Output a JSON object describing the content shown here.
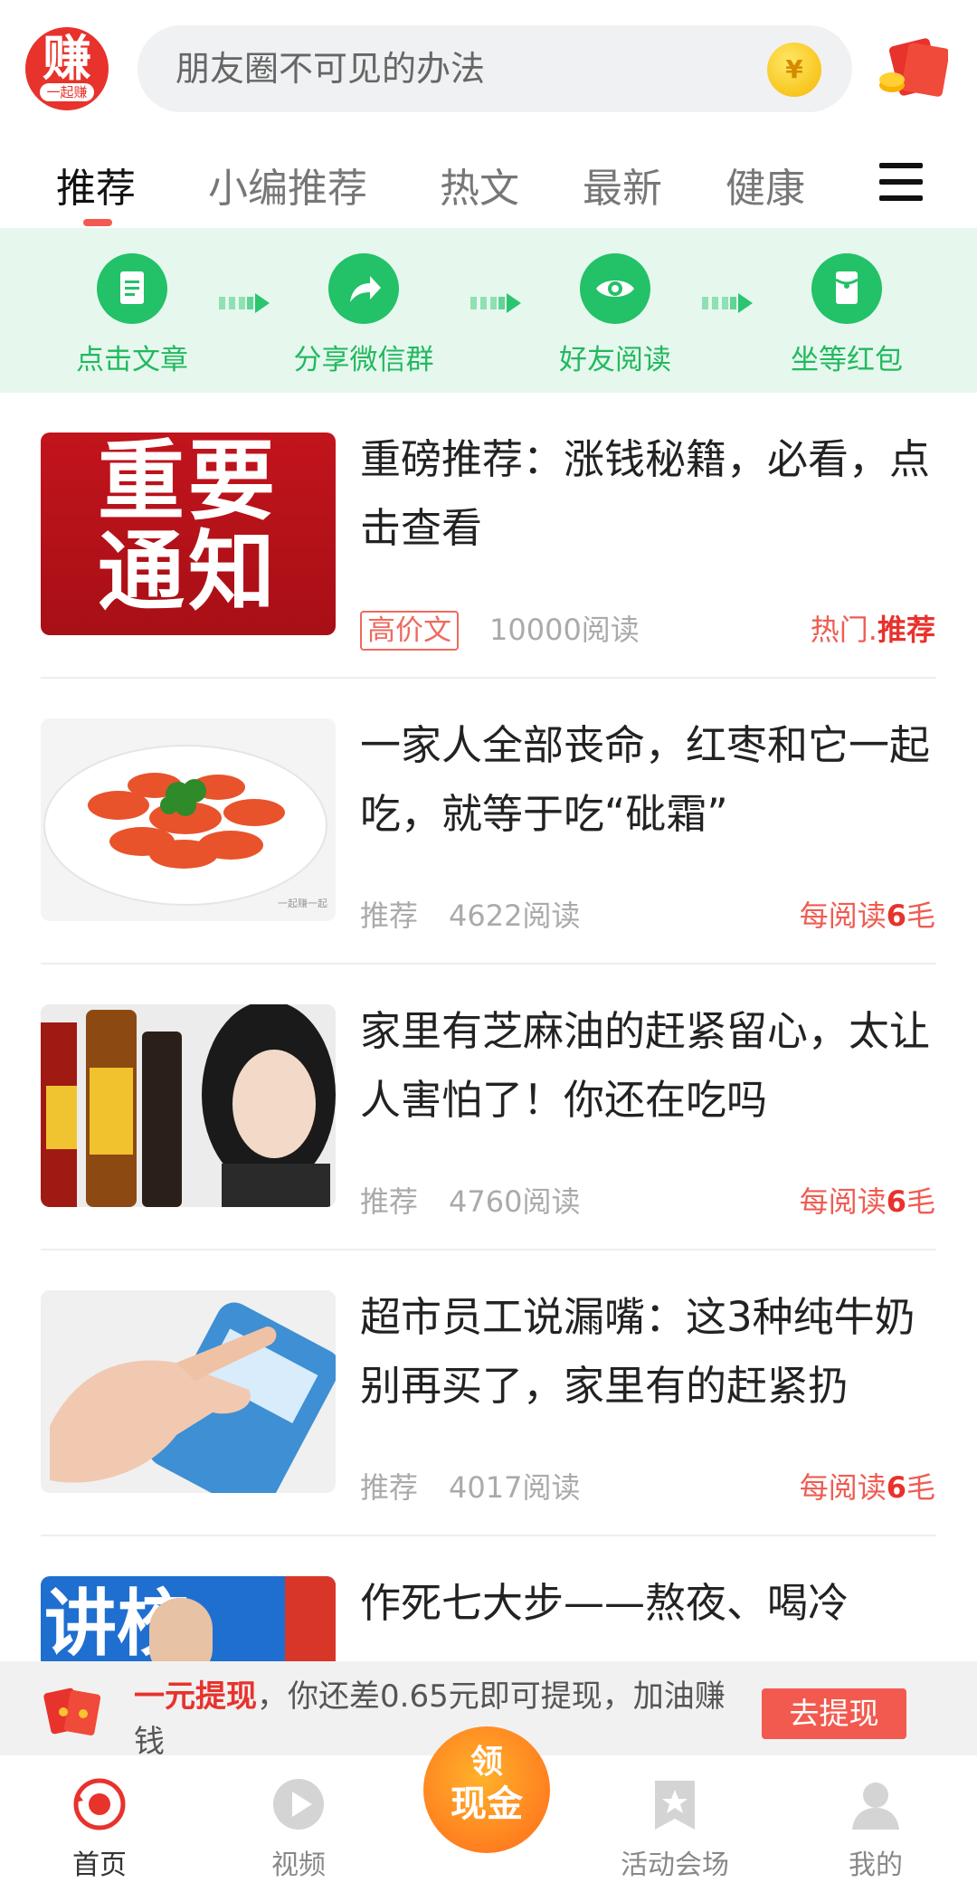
{
  "header": {
    "logo_text": "赚",
    "logo_sub": "一起赚",
    "search_placeholder": "朋友圈不可见的办法",
    "coin_symbol": "¥"
  },
  "tabs": [
    {
      "label": "推荐",
      "active": true
    },
    {
      "label": "小编推荐"
    },
    {
      "label": "热文"
    },
    {
      "label": "最新"
    },
    {
      "label": "健康"
    }
  ],
  "steps": [
    {
      "label": "点击文章",
      "icon": "document-icon"
    },
    {
      "label": "分享微信群",
      "icon": "share-icon"
    },
    {
      "label": "好友阅读",
      "icon": "eye-icon"
    },
    {
      "label": "坐等红包",
      "icon": "red-packet-icon"
    }
  ],
  "articles": [
    {
      "title": "重磅推荐：涨钱秘籍，必看，点击查看",
      "thumb_text_1": "重要",
      "thumb_text_2": "通知",
      "tag": "高价文",
      "reads": "10000阅读",
      "reward_prefix": "热门.",
      "reward_bold": "推荐",
      "reward_suffix": ""
    },
    {
      "title": "一家人全部丧命，红枣和它一起吃，就等于吃“砒霜”",
      "thumb_caption": "一起赚一起",
      "tag": "推荐",
      "reads": "4622阅读",
      "reward_prefix": "每阅读",
      "reward_bold": "6",
      "reward_suffix": "毛"
    },
    {
      "title": "家里有芝麻油的赶紧留心，太让人害怕了！你还在吃吗",
      "tag": "推荐",
      "reads": "4760阅读",
      "reward_prefix": "每阅读",
      "reward_bold": "6",
      "reward_suffix": "毛"
    },
    {
      "title": "超市员工说漏嘴：这3种纯牛奶别再买了，家里有的赶紧扔",
      "tag": "推荐",
      "reads": "4017阅读",
      "reward_prefix": "每阅读",
      "reward_bold": "6",
      "reward_suffix": "毛"
    },
    {
      "title": "作死七大步——熬夜、喝冷",
      "thumb_text": "讲校"
    }
  ],
  "withdraw": {
    "highlight": "一元提现",
    "message": "，你还差0.65元即可提现，加油赚钱",
    "button": "去提现"
  },
  "cash_button": {
    "line1": "领",
    "line2": "现金"
  },
  "bottom_nav": [
    {
      "label": "首页",
      "icon": "home-target-icon",
      "active": true
    },
    {
      "label": "视频",
      "icon": "play-icon"
    },
    {
      "label": "活动会场",
      "icon": "star-bookmark-icon"
    },
    {
      "label": "我的",
      "icon": "user-icon"
    }
  ],
  "colors": {
    "accent": "#e8322c",
    "green": "#23c168",
    "step_bg": "#e6f8ee"
  }
}
